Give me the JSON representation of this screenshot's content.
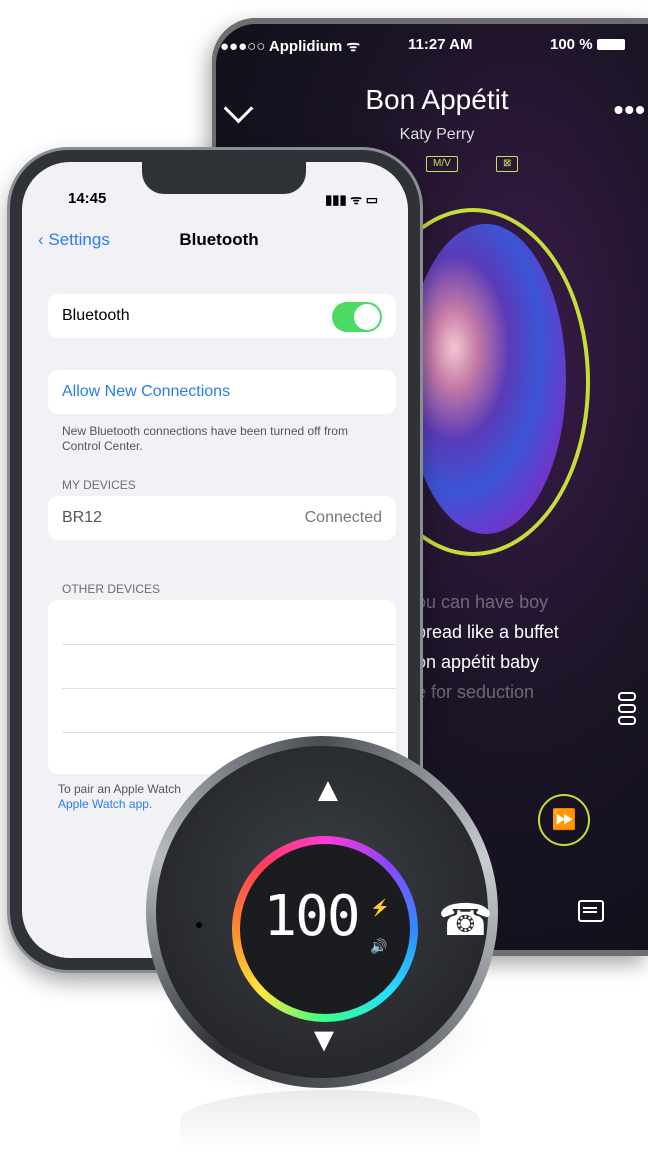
{
  "music_player": {
    "status_carrier": "●●●○○ Applidium ᯤ",
    "status_time": "11:27 AM",
    "status_battery": "100 %",
    "song_title": "Bon Appétit",
    "artist": "Katy Perry",
    "badges": [
      "M/V",
      "⊠"
    ],
    "lyrics": [
      "ou can have boy",
      "pread like a buffet",
      "on appétit baby",
      "e for seduction"
    ],
    "menu_icon": "menu-lines-icon",
    "ffwd_icon": "fast-forward-icon",
    "chat_icon": "chat-icon",
    "accent_color": "#c6dd3a"
  },
  "ios_settings": {
    "time": "14:45",
    "status_icons": "▮▮▮ ᯤ ▭",
    "back_label": "Settings",
    "title": "Bluetooth",
    "bluetooth_label": "Bluetooth",
    "bluetooth_on": true,
    "allow_connections": "Allow New Connections",
    "note": "New Bluetooth connections have been turned off from Control Center.",
    "my_devices_header": "MY DEVICES",
    "device_name": "BR12",
    "device_status": "Connected",
    "other_devices_header": "OTHER DEVICES",
    "pair_note_line1": "To pair an Apple Watch",
    "pair_note_line2": "Apple Watch app.",
    "accent_color": "#2a7df0",
    "toggle_color": "#4cd964"
  },
  "device": {
    "display": "100",
    "up_icon": "▲",
    "down_icon": "▼",
    "phone_icon": "☎"
  }
}
